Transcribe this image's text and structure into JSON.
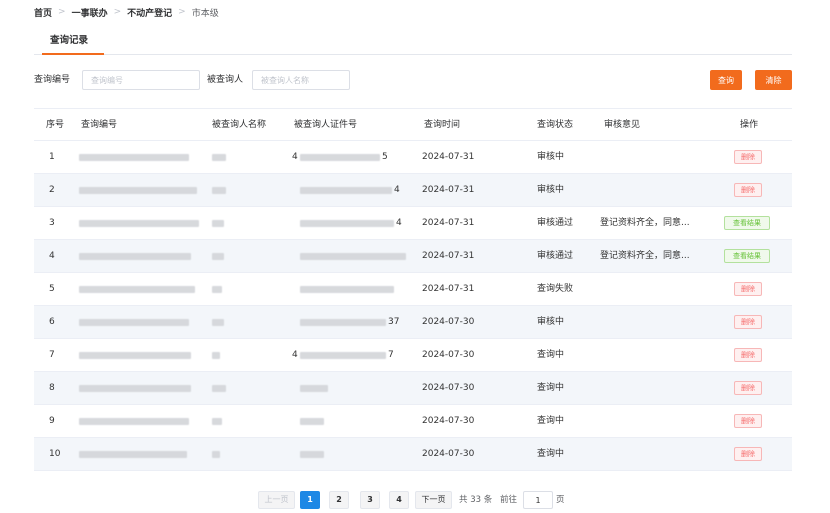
{
  "breadcrumb": {
    "items": [
      "首页",
      "一事联办",
      "不动产登记",
      "市本级"
    ],
    "separator": ">"
  },
  "tabs": [
    {
      "label": "查询记录",
      "active": true
    }
  ],
  "search": {
    "query_no_label": "查询编号",
    "query_no_placeholder": "查询编号",
    "person_label": "被查询人",
    "person_placeholder": "被查询人名称",
    "query_button": "查询",
    "clear_button": "清除"
  },
  "table": {
    "headers": [
      "序号",
      "查询编号",
      "被查询人名称",
      "被查询人证件号",
      "查询时间",
      "查询状态",
      "审核意见",
      "操作"
    ],
    "rows": [
      {
        "index": "1",
        "id_tail": "",
        "name_tail": "",
        "cert_head": "4",
        "cert_tail": "5",
        "time": "2024-07-31",
        "status": "审核中",
        "opinion": "",
        "action": "删除",
        "action_type": "danger"
      },
      {
        "index": "2",
        "id_tail": "",
        "name_tail": "",
        "cert_head": "",
        "cert_tail": "4",
        "time": "2024-07-31",
        "status": "审核中",
        "opinion": "",
        "action": "删除",
        "action_type": "danger"
      },
      {
        "index": "3",
        "id_tail": "",
        "name_tail": "",
        "cert_head": "",
        "cert_tail": "4",
        "time": "2024-07-31",
        "status": "审核通过",
        "opinion": "登记资料齐全，同意...",
        "action": "查看结果",
        "action_type": "success"
      },
      {
        "index": "4",
        "id_tail": "",
        "name_tail": "",
        "cert_head": "",
        "cert_tail": "",
        "time": "2024-07-31",
        "status": "审核通过",
        "opinion": "登记资料齐全，同意...",
        "action": "查看结果",
        "action_type": "success"
      },
      {
        "index": "5",
        "id_tail": "",
        "name_tail": "",
        "cert_head": "",
        "cert_tail": "",
        "time": "2024-07-31",
        "status": "查询失败",
        "opinion": "",
        "action": "删除",
        "action_type": "danger"
      },
      {
        "index": "6",
        "id_tail": "",
        "name_tail": "",
        "cert_head": "",
        "cert_tail": "37",
        "time": "2024-07-30",
        "status": "审核中",
        "opinion": "",
        "action": "删除",
        "action_type": "danger"
      },
      {
        "index": "7",
        "id_tail": "",
        "name_tail": "",
        "cert_head": "4",
        "cert_tail": "7",
        "time": "2024-07-30",
        "status": "查询中",
        "opinion": "",
        "action": "删除",
        "action_type": "danger"
      },
      {
        "index": "8",
        "id_tail": "",
        "name_tail": "",
        "cert_head": "",
        "cert_tail": "",
        "time": "2024-07-30",
        "status": "查询中",
        "opinion": "",
        "action": "删除",
        "action_type": "danger"
      },
      {
        "index": "9",
        "id_tail": "",
        "name_tail": "",
        "cert_head": "",
        "cert_tail": "",
        "time": "2024-07-30",
        "status": "查询中",
        "opinion": "",
        "action": "删除",
        "action_type": "danger"
      },
      {
        "index": "10",
        "id_tail": "",
        "name_tail": "",
        "cert_head": "",
        "cert_tail": "",
        "time": "2024-07-30",
        "status": "查询中",
        "opinion": "",
        "action": "删除",
        "action_type": "danger"
      }
    ]
  },
  "pagination": {
    "prev": "上一页",
    "pages": [
      "1",
      "2",
      "3",
      "4"
    ],
    "current_page": "1",
    "next": "下一页",
    "total_text": "共 33 条",
    "goto_label": "前往",
    "goto_value": "1",
    "page_suffix": "页"
  },
  "colors": {
    "accent": "#f26b1d",
    "active_page": "#1e88e5",
    "danger": "#f56c6c",
    "success": "#67c23a",
    "stripe": "#f3f6fa"
  }
}
